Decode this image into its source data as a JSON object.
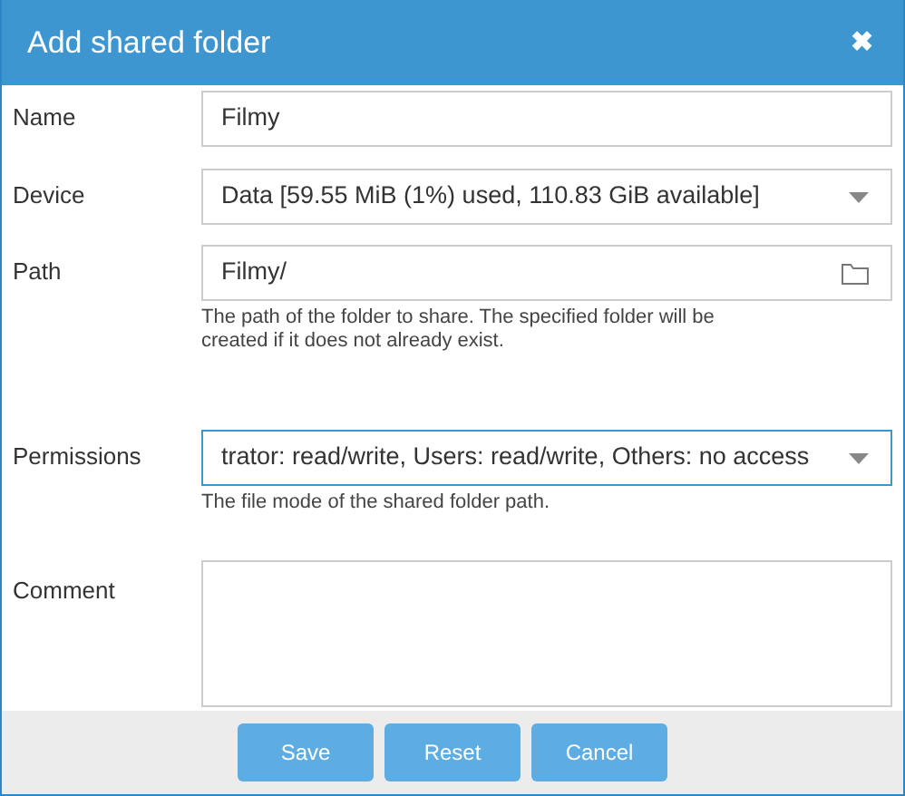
{
  "window": {
    "title": "Add shared folder",
    "close": "✖"
  },
  "fields": [
    {
      "kind": "text",
      "label": "Name",
      "value": "Filmy",
      "focused": false
    },
    {
      "kind": "select",
      "label": "Device",
      "value": "Data [59.55 MiB (1%) used, 110.83 GiB available]",
      "focused": false
    },
    {
      "kind": "path",
      "label": "Path",
      "value": "Filmy/",
      "hint": "The path of the folder to share. The specified folder will be created if it does not already exist.",
      "focused": false
    },
    {
      "kind": "select",
      "label": "Permissions",
      "value": "trator: read/write, Users: read/write, Others: no access",
      "hint": "The file mode of the shared folder path.",
      "focused": true
    },
    {
      "kind": "textarea",
      "label": "Comment",
      "focused": false
    }
  ],
  "buttons": [
    "Save",
    "Reset",
    "Cancel"
  ]
}
